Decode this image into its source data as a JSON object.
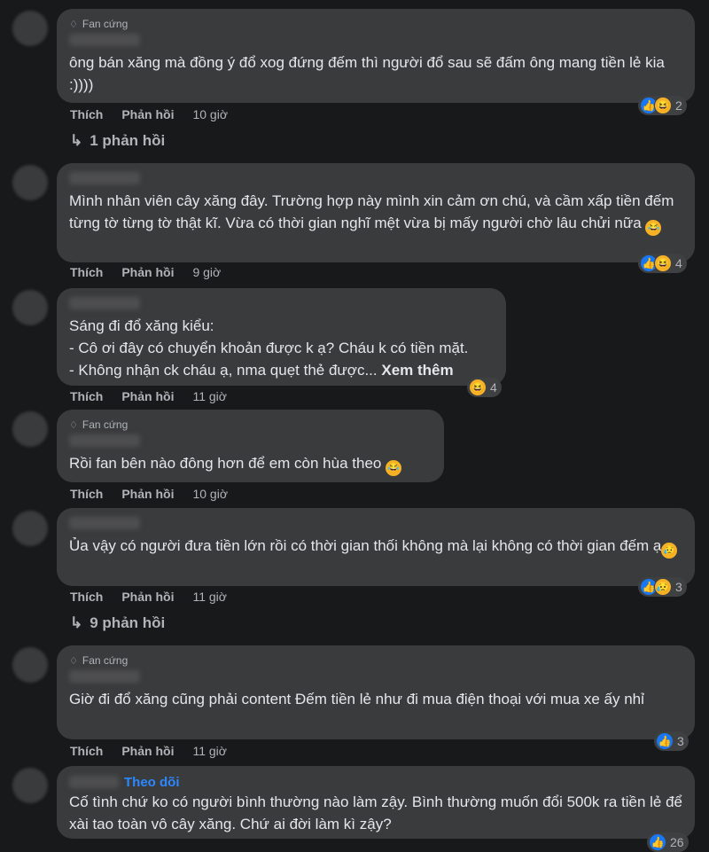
{
  "comments": [
    {
      "badge": "Fan cứng",
      "text": "ông bán xăng mà đồng ý đổ xog đứng đếm thì người đổ sau sẽ đấm ông mang tiền lẻ kia :))))",
      "like": "Thích",
      "reply": "Phản hồi",
      "time": "10 giờ",
      "reactions": [
        "like",
        "haha"
      ],
      "reaction_count": "2",
      "replies": "1 phản hồi"
    },
    {
      "text": "Mình nhân viên cây xăng đây. Trường hợp này mình xin cảm ơn chú, và cầm xấp tiền đếm từng tờ từng tờ thật kĩ. Vừa có thời gian nghĩ mệt vừa bị mấy người chờ lâu chửi nữa",
      "like": "Thích",
      "reply": "Phản hồi",
      "time": "9 giờ",
      "reactions": [
        "like",
        "haha"
      ],
      "reaction_count": "4"
    },
    {
      "text": "Sáng đi đổ xăng kiểu:\n- Cô ơi đây có chuyển khoản được k ạ? Cháu k có tiền mặt.\n- Không nhận ck cháu ạ, nma quẹt thẻ được...",
      "more": "Xem thêm",
      "like": "Thích",
      "reply": "Phản hồi",
      "time": "11 giờ",
      "reactions": [
        "haha"
      ],
      "reaction_count": "4"
    },
    {
      "badge": "Fan cứng",
      "text": "Rồi fan bên nào đông hơn để em còn hùa theo",
      "like": "Thích",
      "reply": "Phản hồi",
      "time": "10 giờ"
    },
    {
      "text": "Ủa vậy có người đưa tiền lớn rồi có thời gian thối không mà lại không có thời gian đếm ạ",
      "like": "Thích",
      "reply": "Phản hồi",
      "time": "11 giờ",
      "reactions": [
        "like",
        "sad"
      ],
      "reaction_count": "3",
      "replies": "9 phản hồi"
    },
    {
      "badge": "Fan cứng",
      "text": "Giờ đi đổ xăng cũng phải content Đếm tiền lẻ như đi mua điện thoại với mua xe ấy nhỉ",
      "like": "Thích",
      "reply": "Phản hồi",
      "time": "11 giờ",
      "reactions": [
        "like"
      ],
      "reaction_count": "3"
    },
    {
      "follow": "Theo dõi",
      "text": "Cố tình chứ ko có người bình thường nào làm zậy. Bình thường muốn đổi 500k ra tiền lẻ để xài tao toàn vô cây xăng. Chứ ai đời làm kì zậy?",
      "reactions": [
        "like"
      ],
      "reaction_count": "26"
    }
  ],
  "icons": {
    "badge": "diamond-icon",
    "reply_arrow": "reply-arrow-icon",
    "like": "like-reaction-icon",
    "haha": "haha-reaction-icon",
    "sad": "sad-reaction-icon",
    "emoji": "laughing-emoji-icon"
  },
  "colors": {
    "background": "#18191a",
    "bubble": "#3a3b3c",
    "text": "#e4e6eb",
    "muted": "#b0b3b8",
    "accent": "#2d88ff",
    "like": "#1877f2"
  }
}
